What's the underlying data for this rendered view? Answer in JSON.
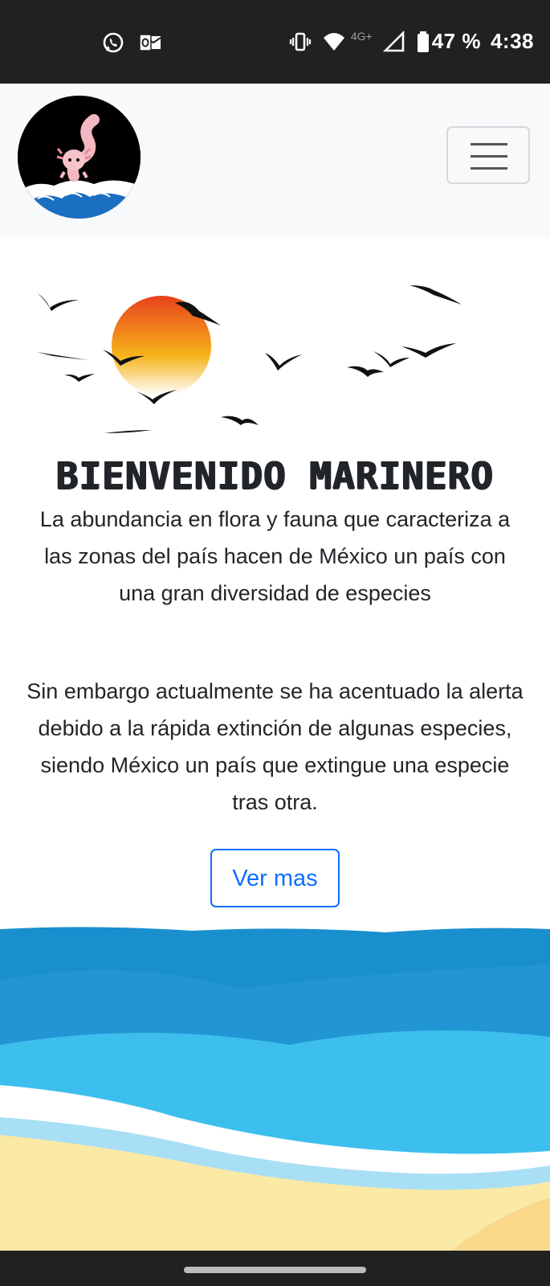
{
  "status_bar": {
    "battery_text": "47 %",
    "time": "4:38",
    "network_label": "4G+",
    "icons": [
      "whatsapp-icon",
      "outlook-icon",
      "vibrate-icon",
      "wifi-icon",
      "signal-icon",
      "battery-icon"
    ]
  },
  "navbar": {
    "logo_icon": "axolotl-logo-icon",
    "toggler_icon": "hamburger-menu-icon"
  },
  "hero": {
    "headline": "BIENVENIDO MARINERO",
    "paragraph_1": "La abundancia en flora y fauna que caracteriza a las zonas del país hacen de México un país con una gran diversidad de especies",
    "paragraph_2": "Sin embargo actualmente se ha acentuado la alerta debido a la rápida extinción de algunas especies, siendo México un país que extingue una especie tras otra.",
    "button_label": "Ver mas"
  },
  "colors": {
    "status_bar_bg": "#212121",
    "navbar_bg": "#f8f9fa",
    "button_accent": "#0d6efd",
    "sun_top": "#e8411c",
    "sun_bottom": "#ffffff",
    "sea_dark": "#1a8fce",
    "sea_light": "#3dbfee",
    "sand": "#fbe9a6"
  }
}
